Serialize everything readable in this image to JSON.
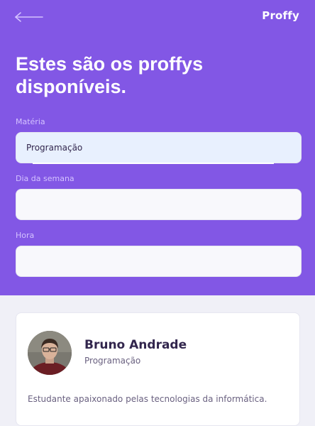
{
  "app": {
    "logo": "Proffy"
  },
  "header": {
    "title": "Estes são os proffys disponíveis."
  },
  "filters": {
    "subject": {
      "label": "Matéria",
      "value": "Programação"
    },
    "week_day": {
      "label": "Dia da semana",
      "value": ""
    },
    "time": {
      "label": "Hora",
      "value": ""
    }
  },
  "teachers": [
    {
      "name": "Bruno Andrade",
      "subject": "Programação",
      "bio": "Estudante apaixonado pelas tecnologias da informática."
    }
  ],
  "colors": {
    "primary": "#8257e5",
    "background": "#f0f0f7",
    "title_text": "#32264d",
    "body_text": "#6a6180",
    "label_text": "#d4c2ff"
  },
  "icons": {
    "back": "back-arrow-icon"
  }
}
